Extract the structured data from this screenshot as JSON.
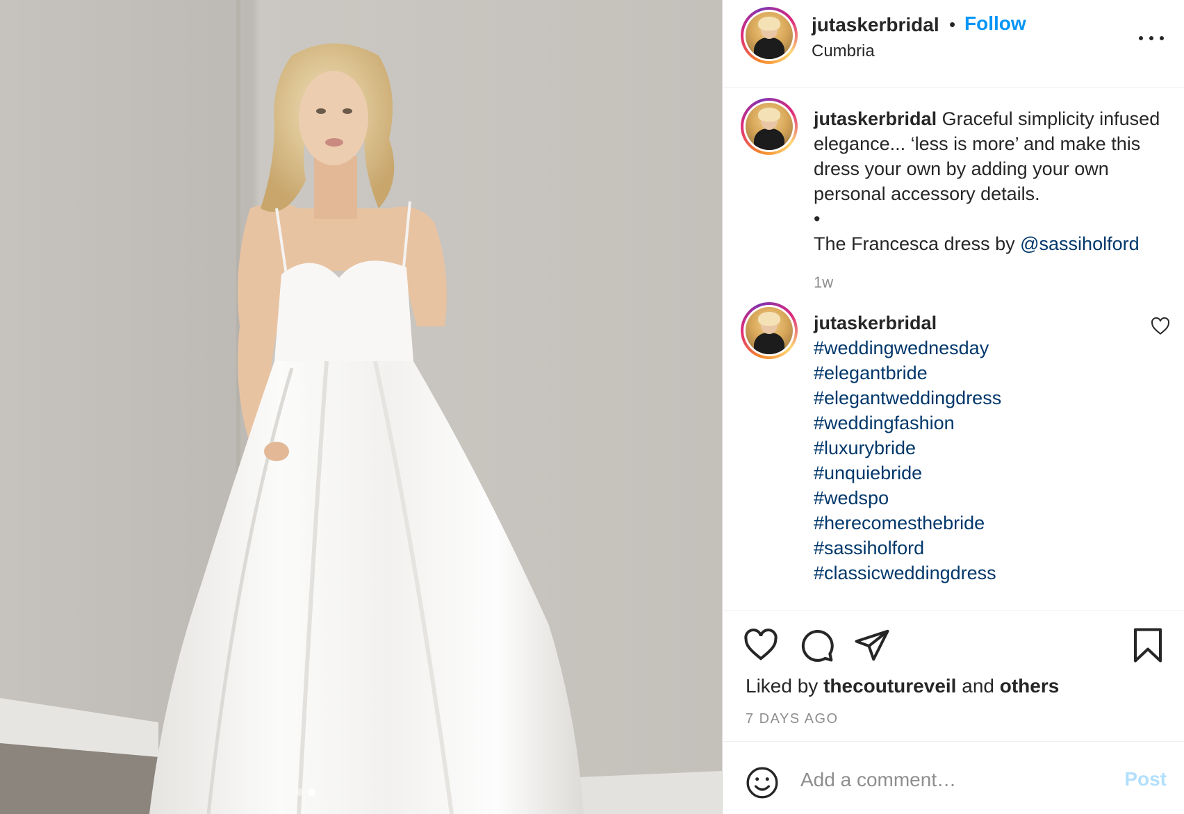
{
  "post": {
    "username": "jutaskerbridal",
    "follow_label": "Follow",
    "separator": "•",
    "location": "Cumbria"
  },
  "caption": {
    "username": "jutaskerbridal",
    "line1": "Graceful simplicity infused elegance... ‘less is more’ and make this dress your own by adding your own personal accessory details.",
    "bullet": "•",
    "line2_prefix": "The Francesca dress by ",
    "mention": "@sassiholford",
    "time": "1w"
  },
  "hashtag_comment": {
    "username": "jutaskerbridal",
    "hashtags": [
      "#weddingwednesday",
      "#elegantbride",
      "#elegantweddingdress",
      "#weddingfashion",
      "#luxurybride",
      "#unquiebride",
      "#wedspo",
      "#herecomesthebride",
      "#sassiholford",
      "#classicweddingdress"
    ]
  },
  "engagement": {
    "liked_prefix": "Liked by ",
    "liked_user": "thecoutureveil",
    "liked_and": " and ",
    "liked_others": "others",
    "date": "7 DAYS AGO"
  },
  "comment_box": {
    "placeholder": "Add a comment…",
    "post_label": "Post"
  },
  "carousel": {
    "total": 2,
    "active": 2
  },
  "icons": {
    "like": "heart-icon",
    "comment": "comment-bubble-icon",
    "share": "paper-plane-icon",
    "save": "bookmark-icon",
    "emoji": "smiley-icon",
    "more": "more-options-icon"
  },
  "colors": {
    "link_blue": "#0095f6",
    "hashtag_blue": "#00376b",
    "muted_gray": "#8e8e8e",
    "post_disabled": "#b2dffc"
  }
}
